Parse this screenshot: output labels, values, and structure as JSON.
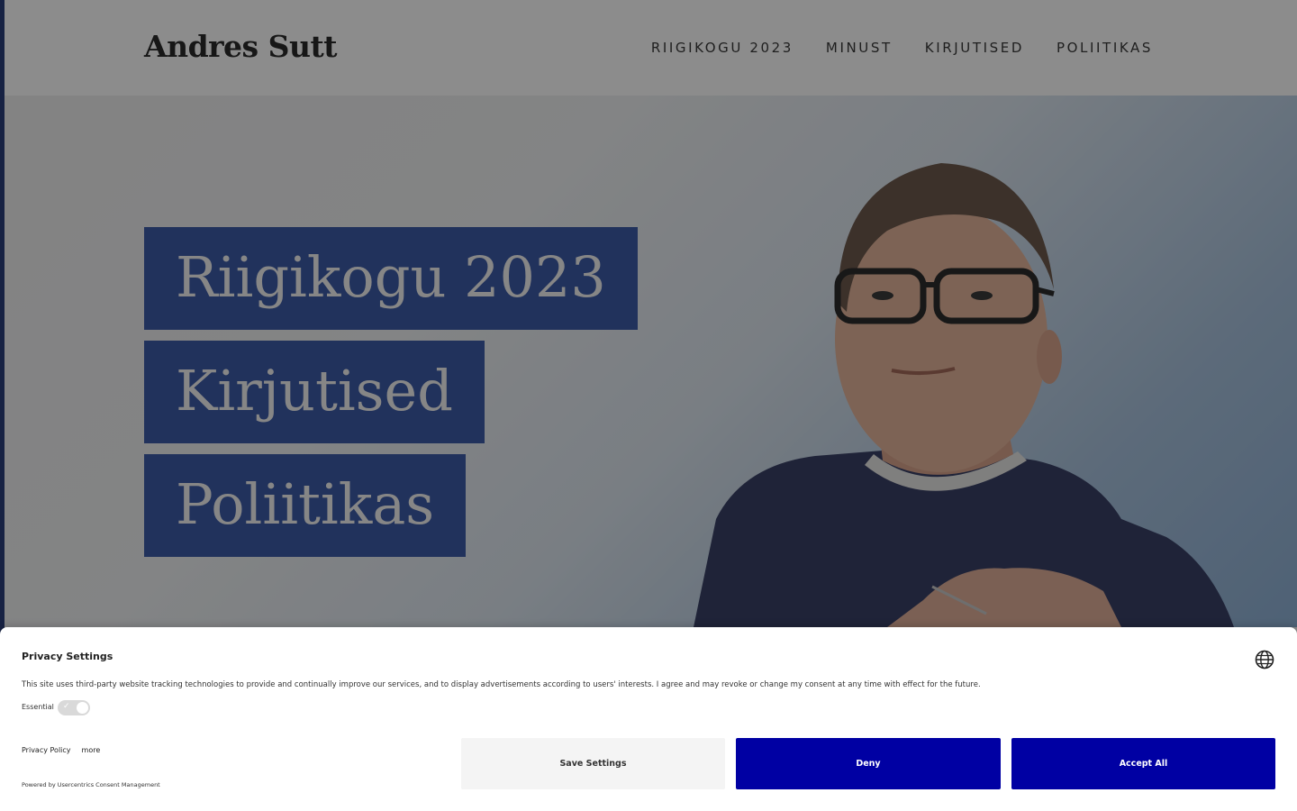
{
  "site": {
    "logo": "Andres Sutt",
    "nav": [
      "RIIGIKOGU 2023",
      "MINUST",
      "KIRJUTISED",
      "POLIITIKAS"
    ]
  },
  "hero": {
    "links": [
      "Riigikogu 2023",
      "Kirjutised",
      "Poliitikas"
    ],
    "portrait_alt": "Portrait photo"
  },
  "consent": {
    "title": "Privacy Settings",
    "text": "This site uses third-party website tracking technologies to provide and continually improve our services, and to display advertisements according to users' interests. I agree and may revoke or change my consent at any time with effect for the future.",
    "essential_label": "Essential",
    "privacy_policy": "Privacy Policy",
    "more": "more",
    "powered_by": "Powered by Usercentrics Consent Management",
    "buttons": {
      "save": "Save Settings",
      "deny": "Deny",
      "accept": "Accept All"
    },
    "globe_icon": "globe-icon"
  },
  "colors": {
    "hero_box": "#3d5ba8",
    "button_primary": "#0000a3",
    "left_border": "#2a3f7a"
  }
}
